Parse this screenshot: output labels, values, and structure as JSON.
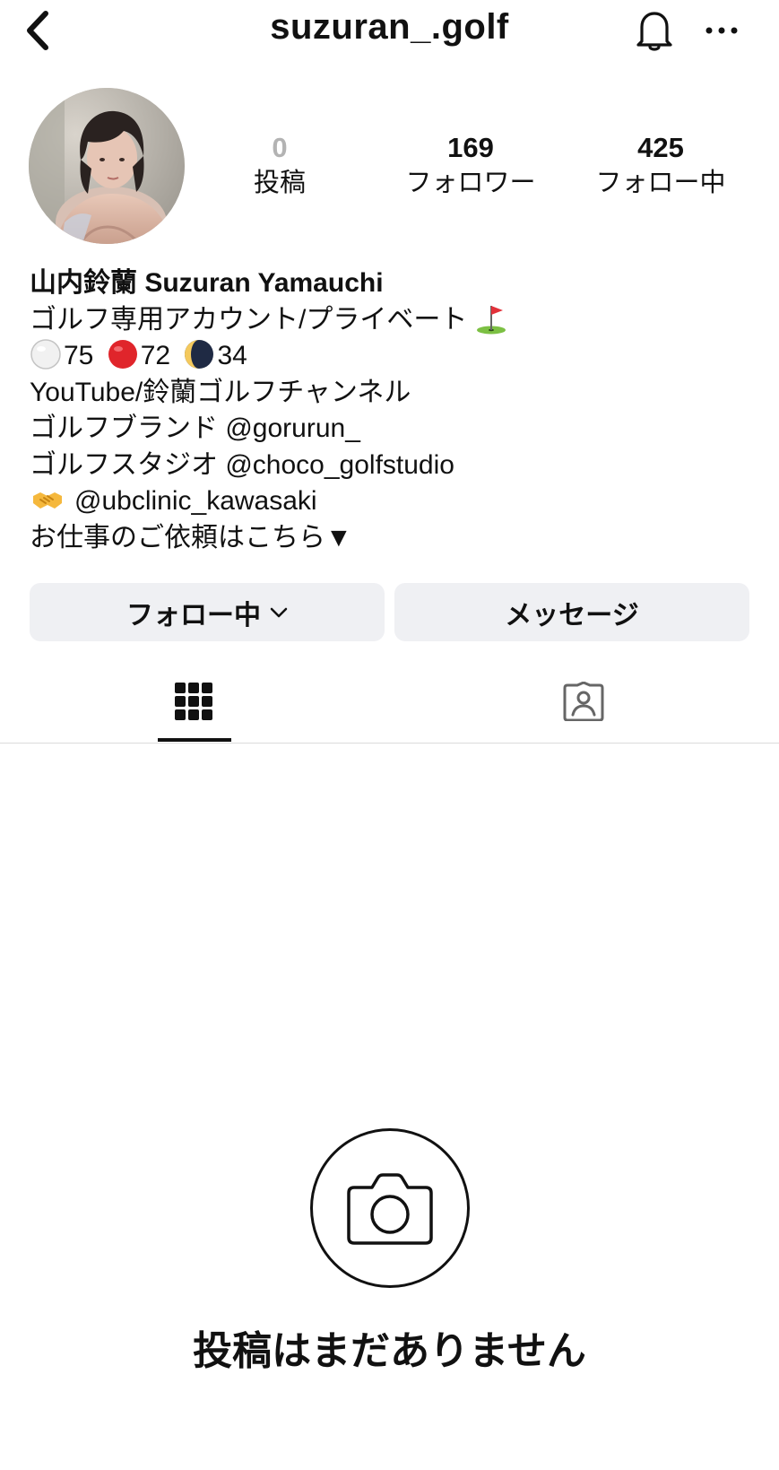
{
  "header": {
    "username": "suzuran_.golf",
    "back_icon": "chevron-left-icon",
    "notification_icon": "bell-icon",
    "more_icon": "ellipsis-icon"
  },
  "profile": {
    "avatar_alt": "profile photo"
  },
  "stats": {
    "posts": {
      "count": "0",
      "label": "投稿"
    },
    "followers": {
      "count": "169",
      "label": "フォロワー"
    },
    "following": {
      "count": "425",
      "label": "フォロー中"
    }
  },
  "bio": {
    "name": "山内鈴蘭 Suzuran Yamauchi",
    "line1": "ゴルフ専用アカウント/プライベート",
    "scores": {
      "white_ball": "75",
      "red_ball": "72",
      "moon": "34"
    },
    "line3": "YouTube/鈴蘭ゴルフチャンネル",
    "line4_prefix": "ゴルフブランド ",
    "line4_link": "@gorurun_",
    "line5_prefix": "ゴルフスタジオ ",
    "line5_link": "@choco_golfstudio",
    "line6_link": "@ubclinic_kawasaki",
    "line7": "お仕事のご依頼はこちら▼"
  },
  "actions": {
    "follow_label": "フォロー中",
    "message_label": "メッセージ"
  },
  "tabs": {
    "active": "grid",
    "grid_icon": "grid-icon",
    "tagged_icon": "tagged-person-icon"
  },
  "empty_state": {
    "icon": "camera-icon",
    "text": "投稿はまだありません"
  },
  "colors": {
    "button_bg": "#eff0f3",
    "muted_count": "#b3b3b3",
    "text": "#111111"
  }
}
